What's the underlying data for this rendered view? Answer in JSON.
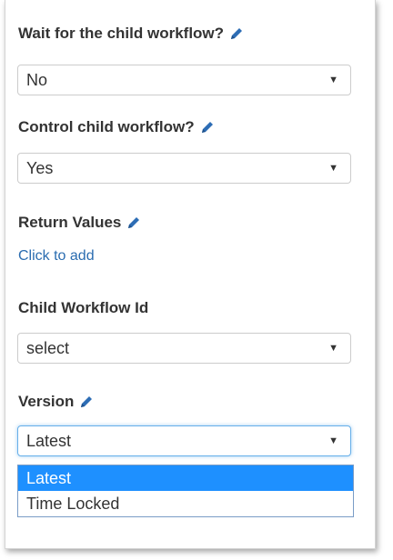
{
  "fields": {
    "wait_child": {
      "label": "Wait for the child workflow?",
      "value": "No",
      "icon": "pencil-icon"
    },
    "control_child": {
      "label": "Control child workflow?",
      "value": "Yes",
      "icon": "pencil-icon"
    },
    "return_values": {
      "label": "Return Values",
      "link": "Click to add",
      "icon": "pencil-icon"
    },
    "child_workflow_id": {
      "label": "Child Workflow Id",
      "value": "select"
    },
    "version": {
      "label": "Version",
      "value": "Latest",
      "icon": "pencil-icon",
      "options": [
        "Latest",
        "Time Locked"
      ]
    }
  },
  "colors": {
    "link": "#2a6cb0",
    "selected_option": "#1e90ff",
    "focus_border": "#66afe9"
  }
}
